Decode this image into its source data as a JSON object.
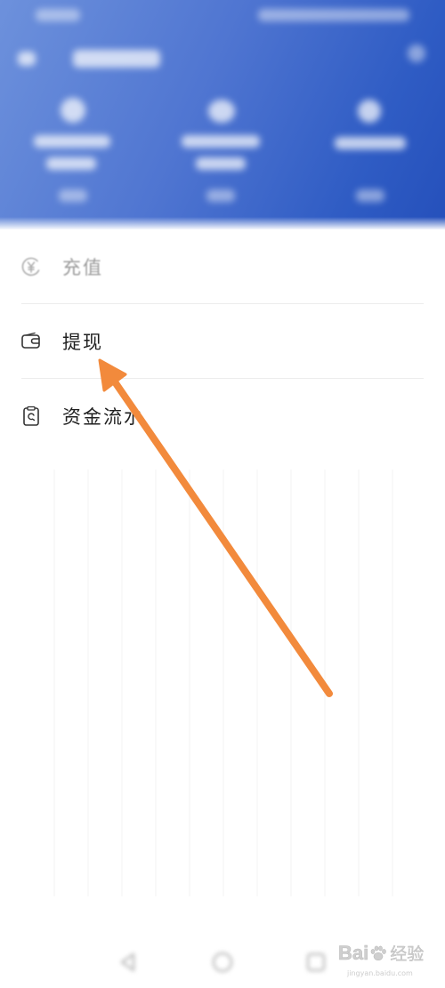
{
  "colors": {
    "header_gradient_start": "#6d91dc",
    "header_gradient_end": "#2550bb",
    "arrow": "#f28a3c",
    "label_text": "#1f1f1f",
    "label_text_dim": "#9c9c9c",
    "divider": "#ececec"
  },
  "menu": {
    "items": [
      {
        "label": "充值",
        "icon": "yuan-circle-icon"
      },
      {
        "label": "提现",
        "icon": "wallet-icon"
      },
      {
        "label": "资金流水",
        "icon": "statement-icon"
      }
    ]
  },
  "navbar": {
    "icons": [
      "back-icon",
      "home-icon",
      "recents-icon"
    ]
  },
  "watermark": {
    "brand": "Bai",
    "product": "经验",
    "url": "jingyan.baidu.com"
  }
}
